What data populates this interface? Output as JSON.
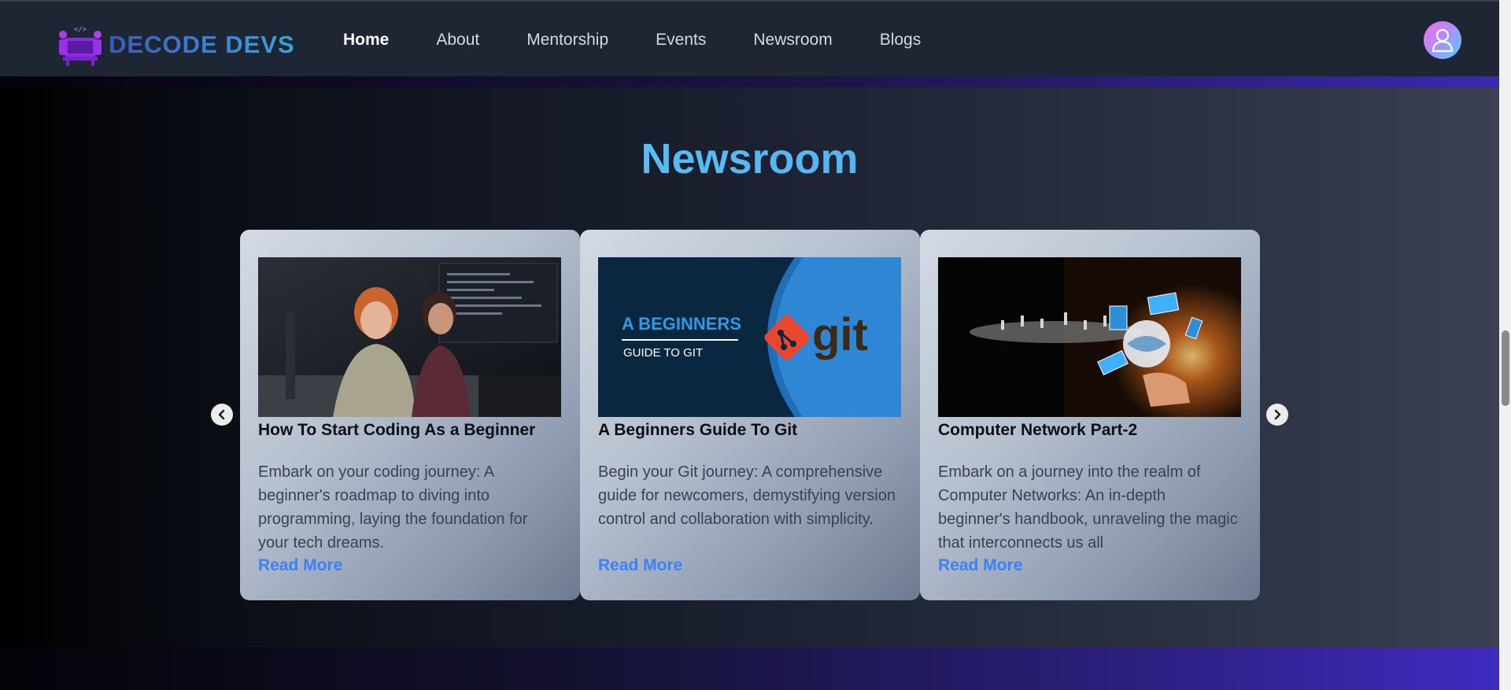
{
  "brand": {
    "name": "DECODE DEVS"
  },
  "nav": {
    "items": [
      {
        "label": "Home",
        "active": true
      },
      {
        "label": "About",
        "active": false
      },
      {
        "label": "Mentorship",
        "active": false
      },
      {
        "label": "Events",
        "active": false
      },
      {
        "label": "Newsroom",
        "active": false
      },
      {
        "label": "Blogs",
        "active": false
      }
    ]
  },
  "section": {
    "title": "Newsroom"
  },
  "cards": [
    {
      "title": "How To Start Coding As a Beginner",
      "text": "Embark on your coding journey: A beginner's roadmap to diving into programming, laying the foundation for your tech dreams.",
      "link": "Read More"
    },
    {
      "title": "A Beginners Guide To Git",
      "text": "Begin your Git journey: A comprehensive guide for newcomers, demystifying version control and collaboration with simplicity.",
      "link": "Read More",
      "image_heading": "A BEGINNERS",
      "image_subheading": "GUIDE TO GIT",
      "image_brand": "git"
    },
    {
      "title": "Computer Network Part-2",
      "text": "Embark on a journey into the realm of Computer Networks: An in-depth beginner's handbook, unraveling the magic that interconnects us all",
      "link": "Read More"
    }
  ],
  "icons": {
    "prev": "chevron-left-icon",
    "next": "chevron-right-icon",
    "avatar": "user-icon"
  },
  "colors": {
    "accent": "#3b82f6",
    "title_gradient_start": "#5ed6f5",
    "title_gradient_end": "#4f9cf0",
    "nav_bg": "#1e2533"
  }
}
